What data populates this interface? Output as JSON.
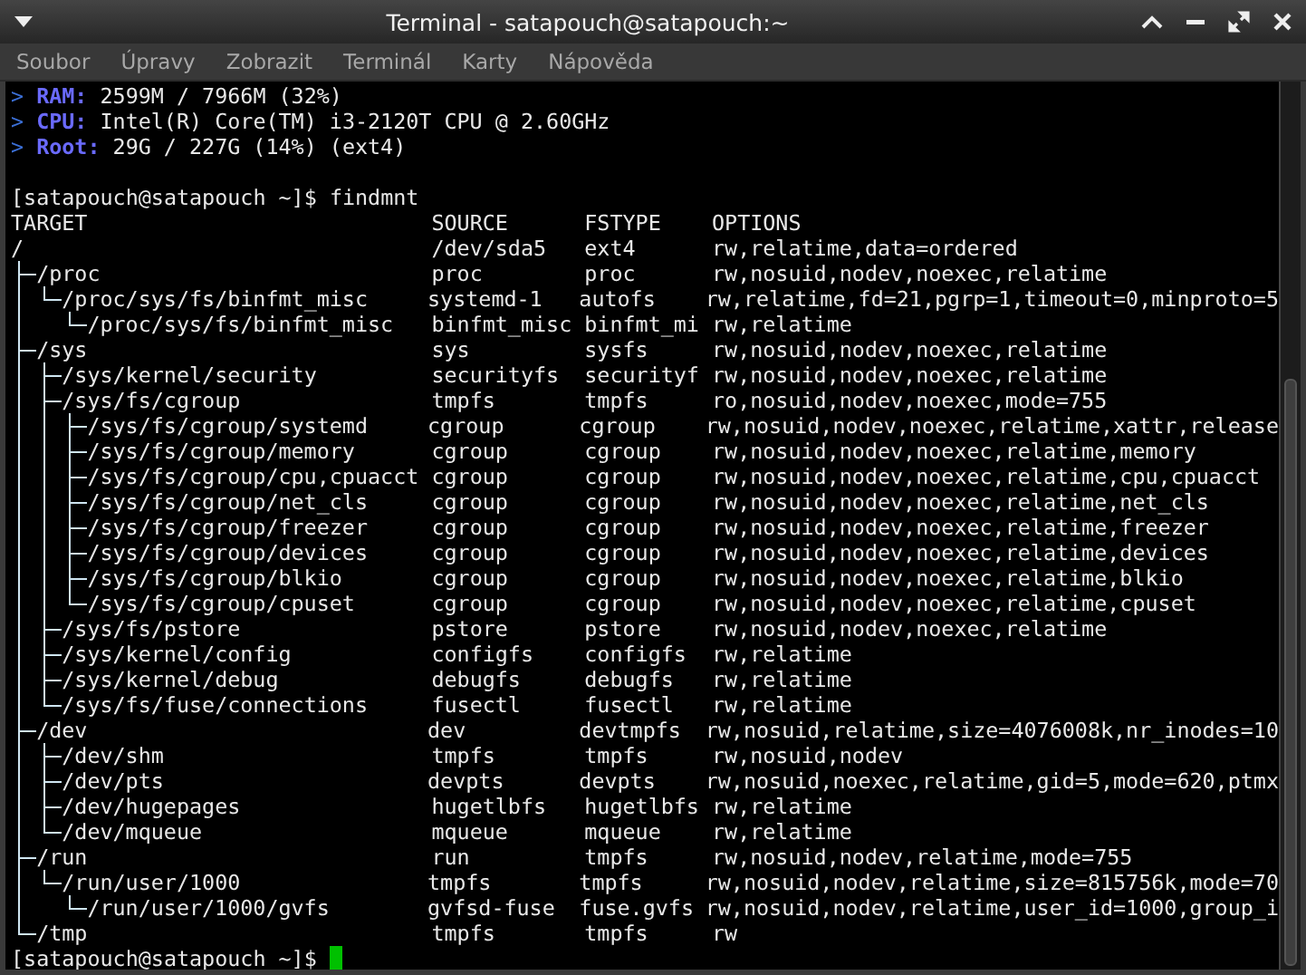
{
  "window": {
    "title": "Terminal - satapouch@satapouch:~"
  },
  "menu": [
    "Soubor",
    "Úpravy",
    "Zobrazit",
    "Terminál",
    "Karty",
    "Nápověda"
  ],
  "terminal": {
    "info": [
      {
        "marker": ">",
        "label": "RAM:",
        "value": "2599M / 7966M (32%)"
      },
      {
        "marker": ">",
        "label": "CPU:",
        "value": "Intel(R) Core(TM) i3-2120T CPU @ 2.60GHz"
      },
      {
        "marker": ">",
        "label": "Root:",
        "value": "29G / 227G (14%) (ext4)"
      }
    ],
    "prompt": "[satapouch@satapouch ~]$",
    "command": "findmnt",
    "columns": [
      "TARGET",
      "SOURCE",
      "FSTYPE",
      "OPTIONS"
    ],
    "mounts": [
      {
        "target": "/",
        "source": "/dev/sda5",
        "fstype": "ext4",
        "options": "rw,relatime,data=ordered",
        "children": [
          {
            "target": "/proc",
            "source": "proc",
            "fstype": "proc",
            "options": "rw,nosuid,nodev,noexec,relatime",
            "children": [
              {
                "target": "/proc/sys/fs/binfmt_misc",
                "source": "systemd-1",
                "fstype": "autofs",
                "options": "rw,relatime,fd=21,pgrp=1,timeout=0,minproto=5",
                "children": [
                  {
                    "target": "/proc/sys/fs/binfmt_misc",
                    "source": "binfmt_misc",
                    "fstype": "binfmt_mi",
                    "options": "rw,relatime"
                  }
                ]
              }
            ]
          },
          {
            "target": "/sys",
            "source": "sys",
            "fstype": "sysfs",
            "options": "rw,nosuid,nodev,noexec,relatime",
            "children": [
              {
                "target": "/sys/kernel/security",
                "source": "securityfs",
                "fstype": "securityf",
                "options": "rw,nosuid,nodev,noexec,relatime"
              },
              {
                "target": "/sys/fs/cgroup",
                "source": "tmpfs",
                "fstype": "tmpfs",
                "options": "ro,nosuid,nodev,noexec,mode=755",
                "children": [
                  {
                    "target": "/sys/fs/cgroup/systemd",
                    "source": "cgroup",
                    "fstype": "cgroup",
                    "options": "rw,nosuid,nodev,noexec,relatime,xattr,release"
                  },
                  {
                    "target": "/sys/fs/cgroup/memory",
                    "source": "cgroup",
                    "fstype": "cgroup",
                    "options": "rw,nosuid,nodev,noexec,relatime,memory"
                  },
                  {
                    "target": "/sys/fs/cgroup/cpu,cpuacct",
                    "source": "cgroup",
                    "fstype": "cgroup",
                    "options": "rw,nosuid,nodev,noexec,relatime,cpu,cpuacct"
                  },
                  {
                    "target": "/sys/fs/cgroup/net_cls",
                    "source": "cgroup",
                    "fstype": "cgroup",
                    "options": "rw,nosuid,nodev,noexec,relatime,net_cls"
                  },
                  {
                    "target": "/sys/fs/cgroup/freezer",
                    "source": "cgroup",
                    "fstype": "cgroup",
                    "options": "rw,nosuid,nodev,noexec,relatime,freezer"
                  },
                  {
                    "target": "/sys/fs/cgroup/devices",
                    "source": "cgroup",
                    "fstype": "cgroup",
                    "options": "rw,nosuid,nodev,noexec,relatime,devices"
                  },
                  {
                    "target": "/sys/fs/cgroup/blkio",
                    "source": "cgroup",
                    "fstype": "cgroup",
                    "options": "rw,nosuid,nodev,noexec,relatime,blkio"
                  },
                  {
                    "target": "/sys/fs/cgroup/cpuset",
                    "source": "cgroup",
                    "fstype": "cgroup",
                    "options": "rw,nosuid,nodev,noexec,relatime,cpuset"
                  }
                ]
              },
              {
                "target": "/sys/fs/pstore",
                "source": "pstore",
                "fstype": "pstore",
                "options": "rw,nosuid,nodev,noexec,relatime"
              },
              {
                "target": "/sys/kernel/config",
                "source": "configfs",
                "fstype": "configfs",
                "options": "rw,relatime"
              },
              {
                "target": "/sys/kernel/debug",
                "source": "debugfs",
                "fstype": "debugfs",
                "options": "rw,relatime"
              },
              {
                "target": "/sys/fs/fuse/connections",
                "source": "fusectl",
                "fstype": "fusectl",
                "options": "rw,relatime"
              }
            ]
          },
          {
            "target": "/dev",
            "source": "dev",
            "fstype": "devtmpfs",
            "options": "rw,nosuid,relatime,size=4076008k,nr_inodes=10",
            "children": [
              {
                "target": "/dev/shm",
                "source": "tmpfs",
                "fstype": "tmpfs",
                "options": "rw,nosuid,nodev"
              },
              {
                "target": "/dev/pts",
                "source": "devpts",
                "fstype": "devpts",
                "options": "rw,nosuid,noexec,relatime,gid=5,mode=620,ptmx"
              },
              {
                "target": "/dev/hugepages",
                "source": "hugetlbfs",
                "fstype": "hugetlbfs",
                "options": "rw,relatime"
              },
              {
                "target": "/dev/mqueue",
                "source": "mqueue",
                "fstype": "mqueue",
                "options": "rw,relatime"
              }
            ]
          },
          {
            "target": "/run",
            "source": "run",
            "fstype": "tmpfs",
            "options": "rw,nosuid,nodev,relatime,mode=755",
            "children": [
              {
                "target": "/run/user/1000",
                "source": "tmpfs",
                "fstype": "tmpfs",
                "options": "rw,nosuid,nodev,relatime,size=815756k,mode=70",
                "children": [
                  {
                    "target": "/run/user/1000/gvfs",
                    "source": "gvfsd-fuse",
                    "fstype": "fuse.gvfs",
                    "options": "rw,nosuid,nodev,relatime,user_id=1000,group_i"
                  }
                ]
              }
            ]
          },
          {
            "target": "/tmp",
            "source": "tmpfs",
            "fstype": "tmpfs",
            "options": "rw"
          }
        ]
      }
    ],
    "final_prompt": "[satapouch@satapouch ~]$"
  }
}
